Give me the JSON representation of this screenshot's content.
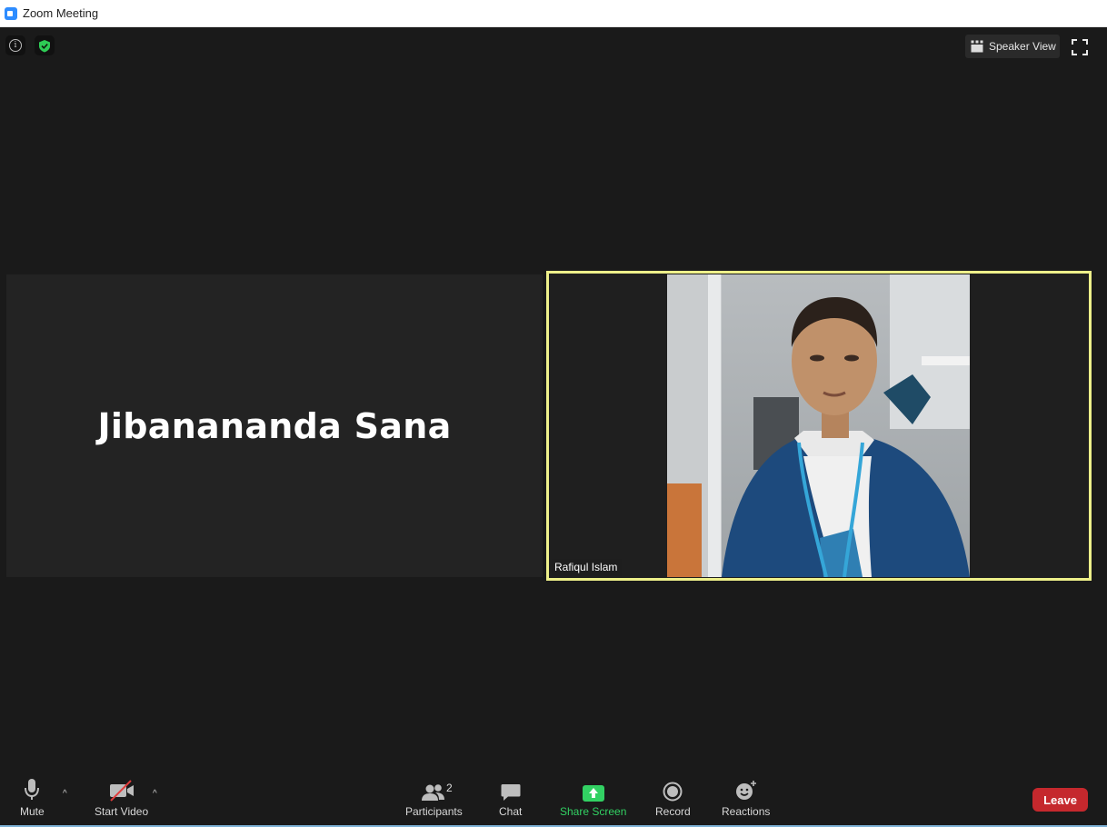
{
  "window": {
    "title": "Zoom Meeting"
  },
  "top_bar": {
    "view_button_label": "Speaker View"
  },
  "participants": [
    {
      "name": "Jibanananda Sana",
      "video_on": false
    },
    {
      "name": "Rafiqul Islam",
      "video_on": true,
      "active_speaker": true
    }
  ],
  "toolbar": {
    "mute_label": "Mute",
    "start_video_label": "Start Video",
    "participants_label": "Participants",
    "participants_count": "2",
    "chat_label": "Chat",
    "share_screen_label": "Share Screen",
    "record_label": "Record",
    "reactions_label": "Reactions",
    "leave_label": "Leave"
  },
  "colors": {
    "background": "#1a1a1a",
    "active_speaker_border": "#eef08a",
    "share_green": "#32d163",
    "leave_red": "#c5282d"
  },
  "icons": [
    "zoom-app-icon",
    "info-icon",
    "security-shield-icon",
    "speaker-view-icon",
    "fullscreen-icon",
    "microphone-icon",
    "video-camera-off-icon",
    "participants-icon",
    "chat-icon",
    "share-screen-icon",
    "record-icon",
    "reactions-icon"
  ]
}
